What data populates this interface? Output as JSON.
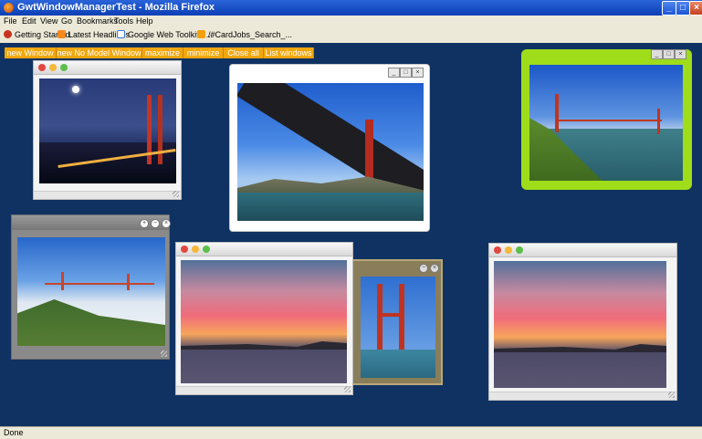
{
  "window": {
    "title": "GwtWindowManagerTest - Mozilla Firefox",
    "minimize_glyph": "_",
    "maximize_glyph": "□",
    "close_glyph": "×"
  },
  "menu": [
    "File",
    "Edit",
    "View",
    "Go",
    "Bookmarks",
    "Tools",
    "Help"
  ],
  "bookmarks": [
    {
      "label": "Getting Started",
      "icon": "firefox-icon"
    },
    {
      "label": "Latest Headlines",
      "icon": "rss-icon"
    },
    {
      "label": "Google Web Toolkit - ...",
      "icon": "google-icon"
    },
    {
      "label": "/#CardJobs_Search_...",
      "icon": "bookmark-icon"
    }
  ],
  "toolbar": [
    "new Window",
    "new No Model Window",
    "maximize",
    "minimize",
    "Close all",
    "List windows"
  ],
  "status": "Done",
  "colors": {
    "desktop": "#0f3263",
    "toolbar": "#f2a70d",
    "green_frame": "#9fdc1a"
  },
  "photos": [
    "golden-gate-night",
    "golden-gate-underneath",
    "golden-gate-green-cliff",
    "golden-gate-fog",
    "sunset-bay",
    "golden-gate-tower",
    "sunset-bay"
  ]
}
